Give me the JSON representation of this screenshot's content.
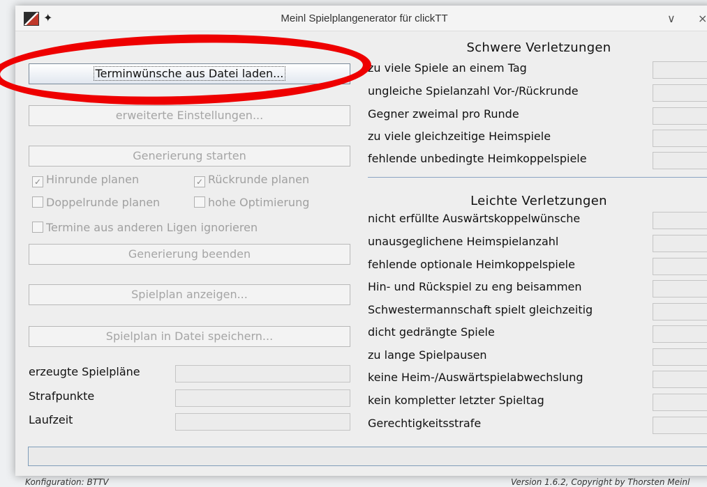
{
  "window": {
    "title": "Meinl Spielplangenerator für clickTT",
    "pin_icon": "pin-icon",
    "app_icon": "app-icon",
    "minimize": "∨",
    "close": "×"
  },
  "left": {
    "btn_load": "Terminwünsche aus Datei laden...",
    "btn_advanced": "erweiterte Einstellungen...",
    "btn_start": "Generierung starten",
    "cb_hinrunde": "Hinrunde planen",
    "cb_rueckrunde": "Rückrunde planen",
    "cb_doppelrunde": "Doppelrunde planen",
    "cb_optimierung": "hohe Optimierung",
    "cb_ignore": "Termine aus anderen Ligen ignorieren",
    "btn_stop": "Generierung beenden",
    "btn_show": "Spielplan anzeigen...",
    "btn_save": "Spielplan in Datei speichern...",
    "stat_plans": "erzeugte Spielpläne",
    "stat_penalty": "Strafpunkte",
    "stat_runtime": "Laufzeit",
    "checkmark": "✓"
  },
  "right": {
    "severe_title": "Schwere Verletzungen",
    "severe": [
      "zu viele Spiele an einem Tag",
      "ungleiche Spielanzahl Vor-/Rückrunde",
      "Gegner zweimal pro Runde",
      "zu viele gleichzeitige Heimspiele",
      "fehlende unbedingte Heimkoppelspiele"
    ],
    "light_title": "Leichte Verletzungen",
    "light": [
      "nicht erfüllte Auswärtskoppelwünsche",
      "unausgeglichene Heimspielanzahl",
      "fehlende optionale Heimkoppelspiele",
      "Hin- und Rückspiel zu eng beisammen",
      "Schwestermannschaft spielt gleichzeitig",
      "dicht gedrängte Spiele",
      "zu lange Spielpausen",
      "keine Heim-/Auswärtspielabwechslung",
      "kein kompletter letzter Spieltag",
      "Gerechtigkeitsstrafe"
    ]
  },
  "footer": {
    "config": "Konfiguration: BTTV",
    "version": "Version 1.6.2, Copyright by Thorsten Meinl"
  },
  "colors": {
    "highlight": "#ee0000",
    "divider": "#8aa3c2"
  }
}
